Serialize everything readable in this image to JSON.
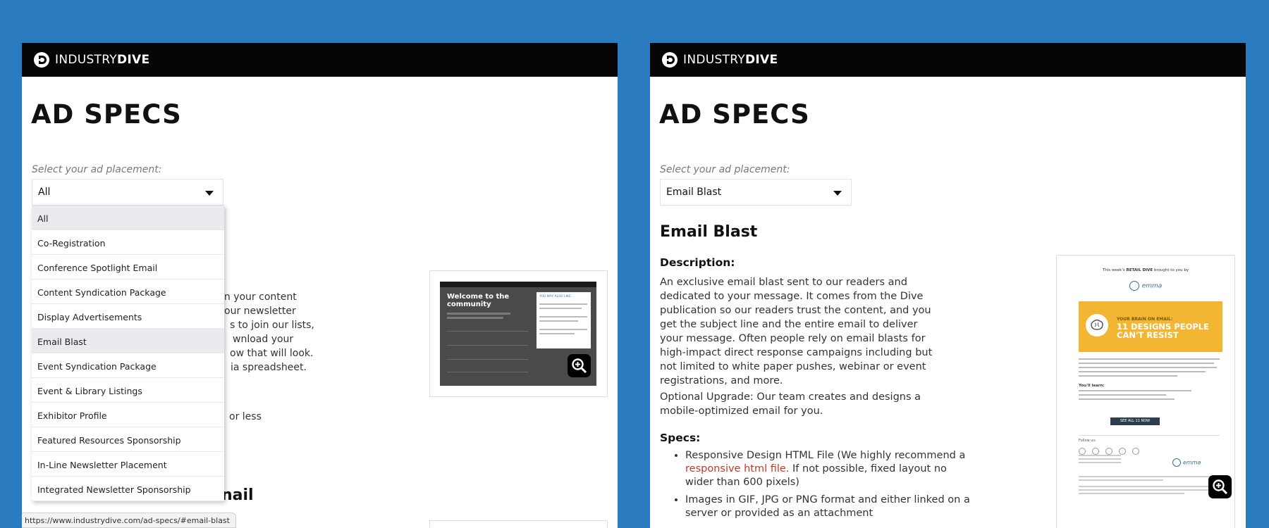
{
  "brand": {
    "name_light": "INDUSTRY",
    "name_bold": "DIVE"
  },
  "left": {
    "title": "AD SPECS",
    "select_label": "Select your ad placement:",
    "selected": "All",
    "dropdown_items": [
      "All",
      "Co-Registration",
      "Conference Spotlight Email",
      "Content Syndication Package",
      "Display Advertisements",
      "Email Blast",
      "Event Syndication Package",
      "Event & Library Listings",
      "Exhibitor Profile",
      "Featured Resources Sponsorship",
      "In-Line Newsletter Placement",
      "Integrated Newsletter Sponsorship"
    ],
    "bg_fragments": [
      "gn your content",
      "our newsletter",
      "s to join our lists,",
      "wnload your",
      "ow that will look.",
      "ia spreadsheet."
    ],
    "bg_fragment_less": "or less",
    "heading_fragment": "nail",
    "thumb": {
      "heading": "Welcome to the community",
      "sidebar_title": "YOU MAY ALSO LIKE..."
    },
    "status_url": "https://www.industrydive.com/ad-specs/#email-blast"
  },
  "right": {
    "title": "AD SPECS",
    "select_label": "Select your ad placement:",
    "selected": "Email Blast",
    "section_title": "Email Blast",
    "description_heading": "Description:",
    "description": "An exclusive email blast sent to our readers and dedicated to your message. It comes from the Dive publication so our readers trust the content, and you get the subject line and the entire email to deliver your message. Often people rely on email blasts for high-impact direct response campaigns including but not limited to white paper pushes, webinar or event registrations, and more.",
    "upgrade": "Optional Upgrade: Our team creates and designs a mobile-optimized email for you.",
    "specs_heading": "Specs:",
    "spec1_before": "Responsive Design HTML File (We highly recommend a ",
    "spec1_link": "responsive html file.",
    "spec1_after": " If not possible, fixed layout no wider than 600 pixels)",
    "spec2": "Images in GIF, JPG or PNG format and either linked on a server or provided as an attachment",
    "thumb": {
      "brought_by": "This week's",
      "brand_retail": "RETAIL DIVE",
      "brought_suffix": "brought to you by",
      "sponsor": "emma",
      "banner_kicker": "YOUR BRAIN ON EMAIL:",
      "banner_line1": "11 DESIGNS PEOPLE",
      "banner_line2": "CAN'T RESIST",
      "learn_heading": "You'll learn:",
      "cta": "SEE ALL 11 NOW",
      "follow": "Follow us:"
    }
  },
  "colors": {
    "background": "#2a7bbf",
    "topbar": "#050505",
    "banner": "#f2b632",
    "link": "#c0392b"
  }
}
